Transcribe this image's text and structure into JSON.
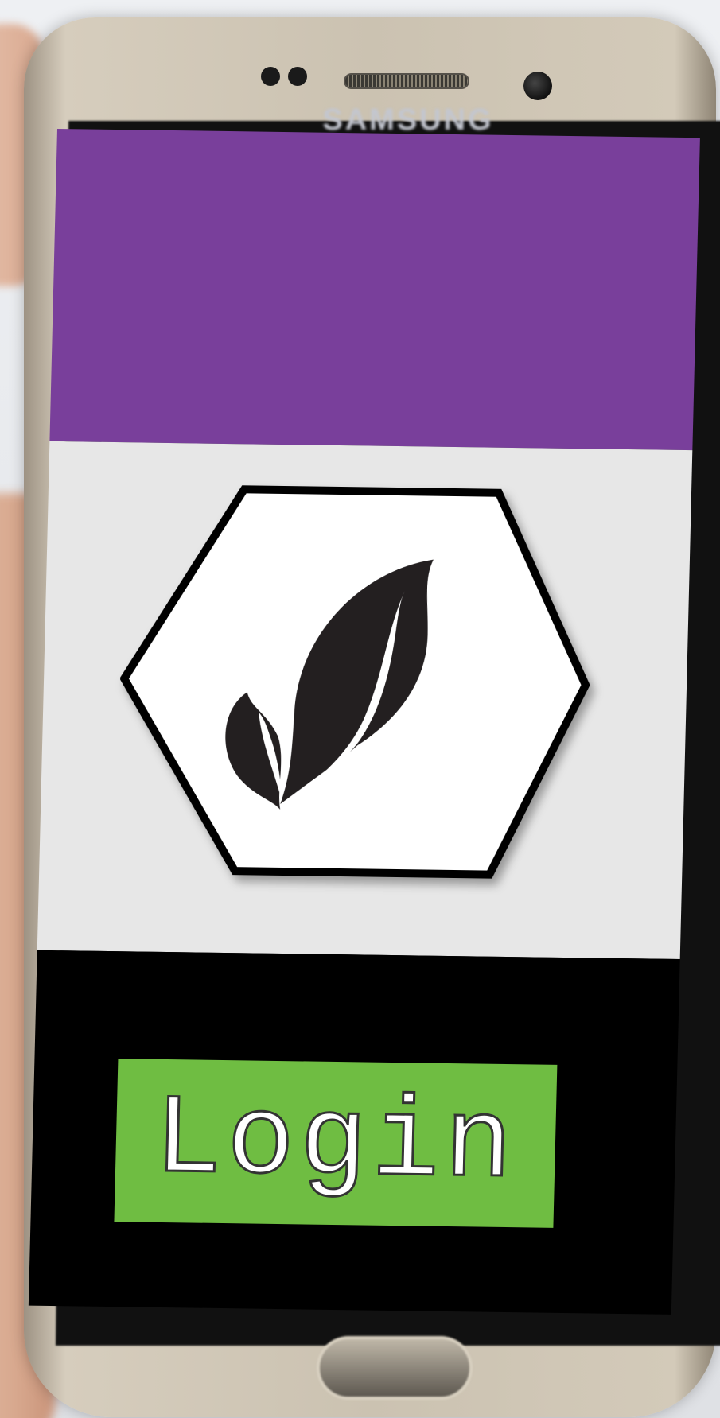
{
  "device": {
    "brand": "SAMSUNG"
  },
  "app": {
    "header": {
      "color": "#793f9b"
    },
    "body": {
      "color": "#e7e7e7",
      "logo_icon": "leaf-icon"
    },
    "footer": {
      "color": "#000000"
    },
    "login_button": {
      "label": "Login",
      "color": "#6fbd42"
    }
  }
}
